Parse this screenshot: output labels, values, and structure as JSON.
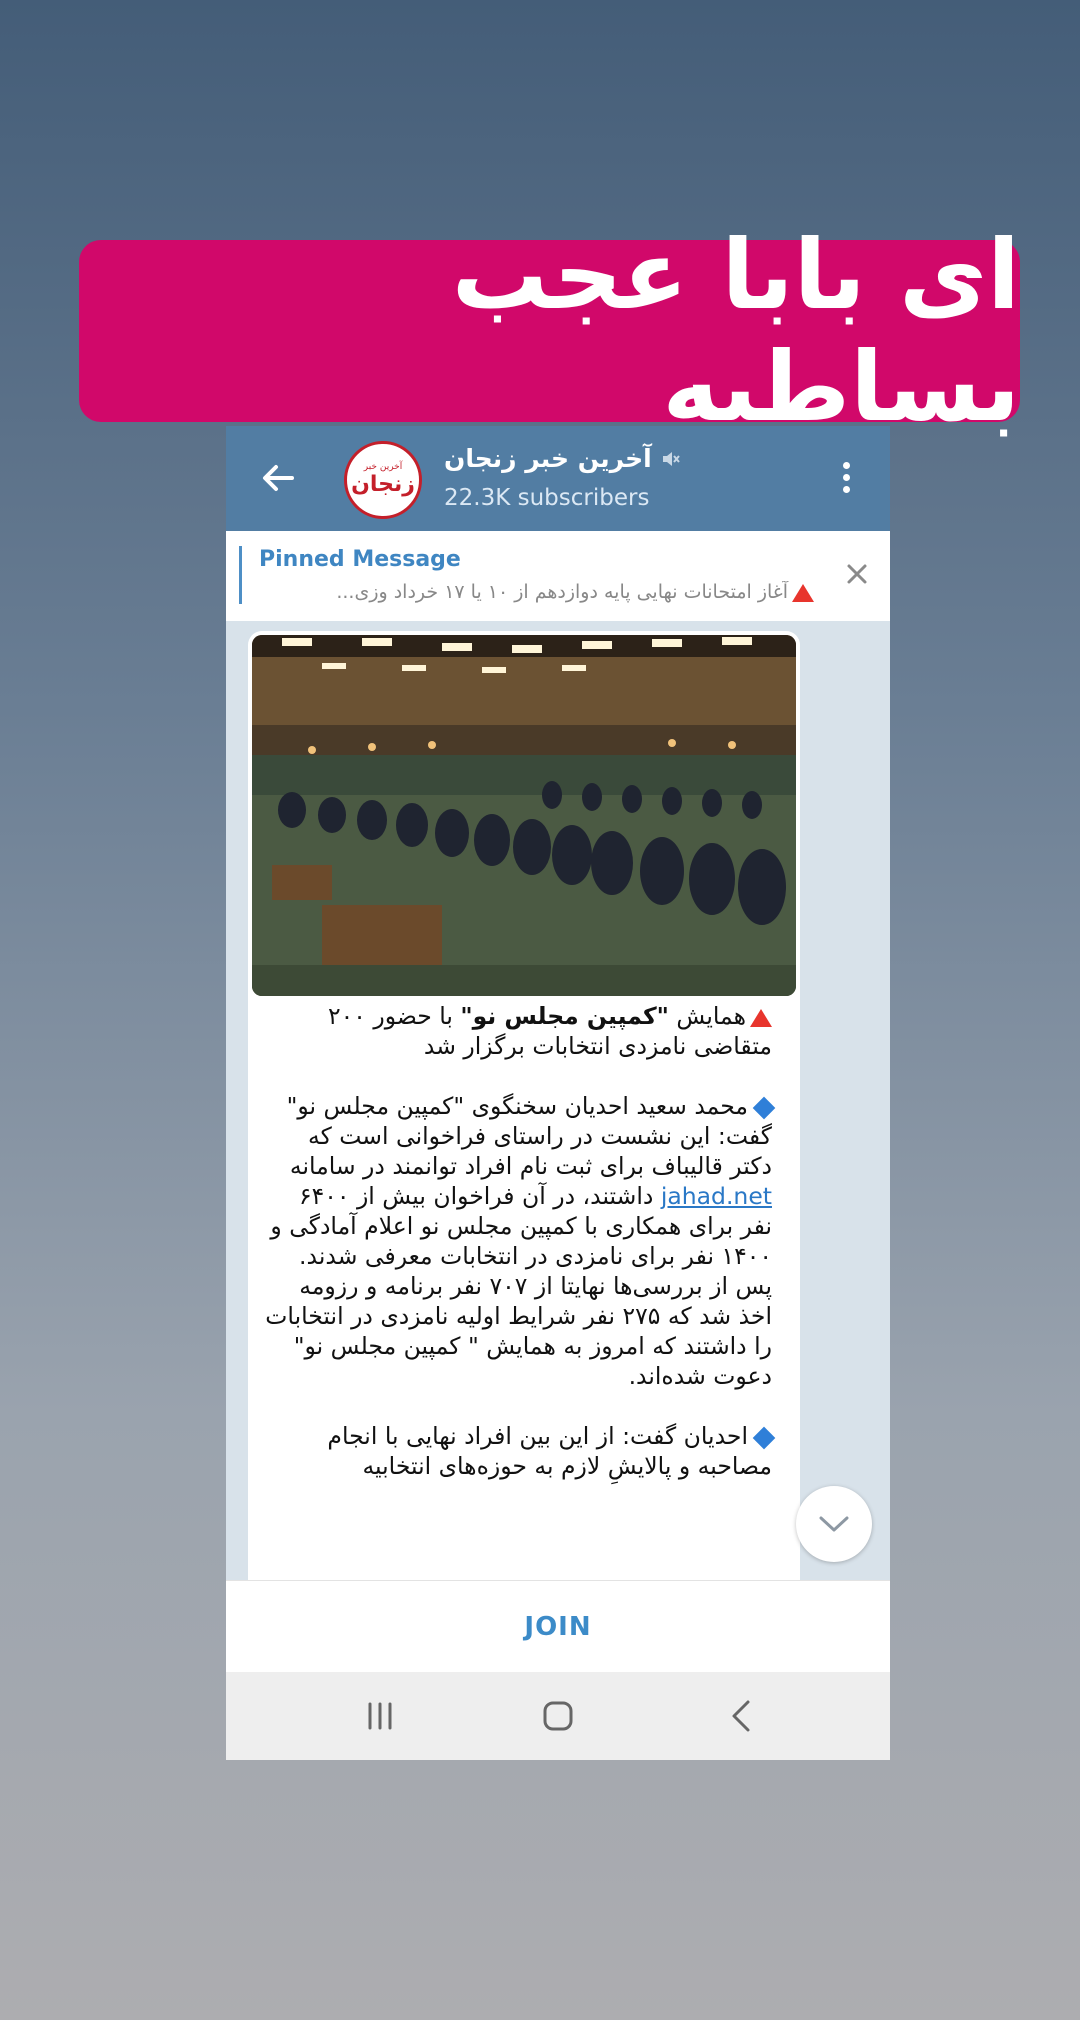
{
  "banner": {
    "text": "ای بابا عجب بساطیه"
  },
  "header": {
    "back_icon": "arrow-left-icon",
    "avatar": {
      "small_text": "آخرین خبر",
      "main_text": "زنجان"
    },
    "channel_name": "آخرین خبر زنجان",
    "muted_icon": "mute-icon",
    "subscribers": "22.3K subscribers",
    "menu_icon": "more-vertical-icon"
  },
  "pinned": {
    "title": "Pinned Message",
    "text": "آغاز امتحانات نهایی پایه دوازدهم از ۱۰ یا ۱۷ خرداد  وزی...",
    "close_icon": "close-icon"
  },
  "message": {
    "headline_prefix": "همایش ",
    "headline_bold": "\"کمپین مجلس نو\"",
    "headline_rest": " با حضور ۲۰۰ متقاضی نامزدی انتخابات برگزار شد",
    "para1_before_link": "محمد سعید احدیان سخنگوی \"کمپین مجلس نو\" گفت: این نشست در راستای فراخوانی است که دکتر قالیباف برای ثبت نام افراد توانمند در سامانه ",
    "para1_link": "jahad.net",
    "para1_after_link": " داشتند، در آن فراخوان بیش از ۶۴۰۰ نفر برای همکاری با کمپین مجلس نو اعلام آمادگی و ۱۴۰۰ نفر برای نامزدی در انتخابات معرفی شدند. پس از بررسی‌ها نهایتا از ۷۰۷ نفر برنامه و رزومه اخذ شد که ۲۷۵ نفر شرایط اولیه نامزدی در انتخابات را داشتند که امروز به همایش \" کمپین مجلس نو\" دعوت شده‌اند.",
    "para2": "احدیان گفت: از این بین افراد نهایی با انجام مصاحبه و پالایشِ لازم به حوزه‌های انتخابیه"
  },
  "scroll_down_icon": "chevron-down-icon",
  "join": {
    "label": "JOIN"
  },
  "navbar": {
    "recents_icon": "recents-icon",
    "home_icon": "home-icon",
    "back_icon": "nav-back-icon"
  },
  "colors": {
    "banner": "#d1086a",
    "header": "#527da3",
    "accent": "#3c8bc8",
    "alert": "#e8352d",
    "diamond": "#2f7fd8"
  }
}
